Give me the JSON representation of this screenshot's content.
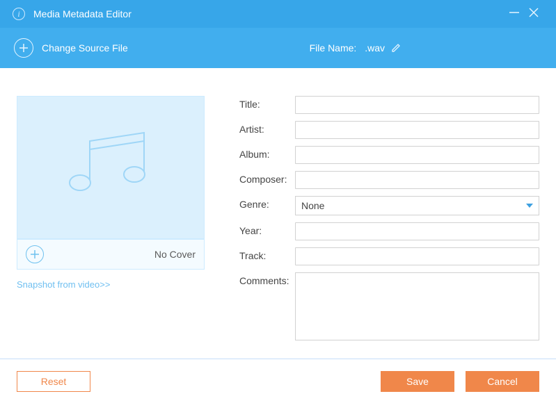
{
  "titlebar": {
    "title": "Media Metadata Editor"
  },
  "toolbar": {
    "change_label": "Change Source File",
    "file_name_label": "File Name:",
    "file_name_value": ".wav"
  },
  "cover": {
    "no_cover_label": "No Cover",
    "snapshot_label": "Snapshot from video>>"
  },
  "form": {
    "labels": {
      "title": "Title:",
      "artist": "Artist:",
      "album": "Album:",
      "composer": "Composer:",
      "genre": "Genre:",
      "year": "Year:",
      "track": "Track:",
      "comments": "Comments:"
    },
    "values": {
      "title": "",
      "artist": "",
      "album": "",
      "composer": "",
      "genre": "None",
      "year": "",
      "track": "",
      "comments": ""
    }
  },
  "footer": {
    "reset": "Reset",
    "save": "Save",
    "cancel": "Cancel"
  }
}
